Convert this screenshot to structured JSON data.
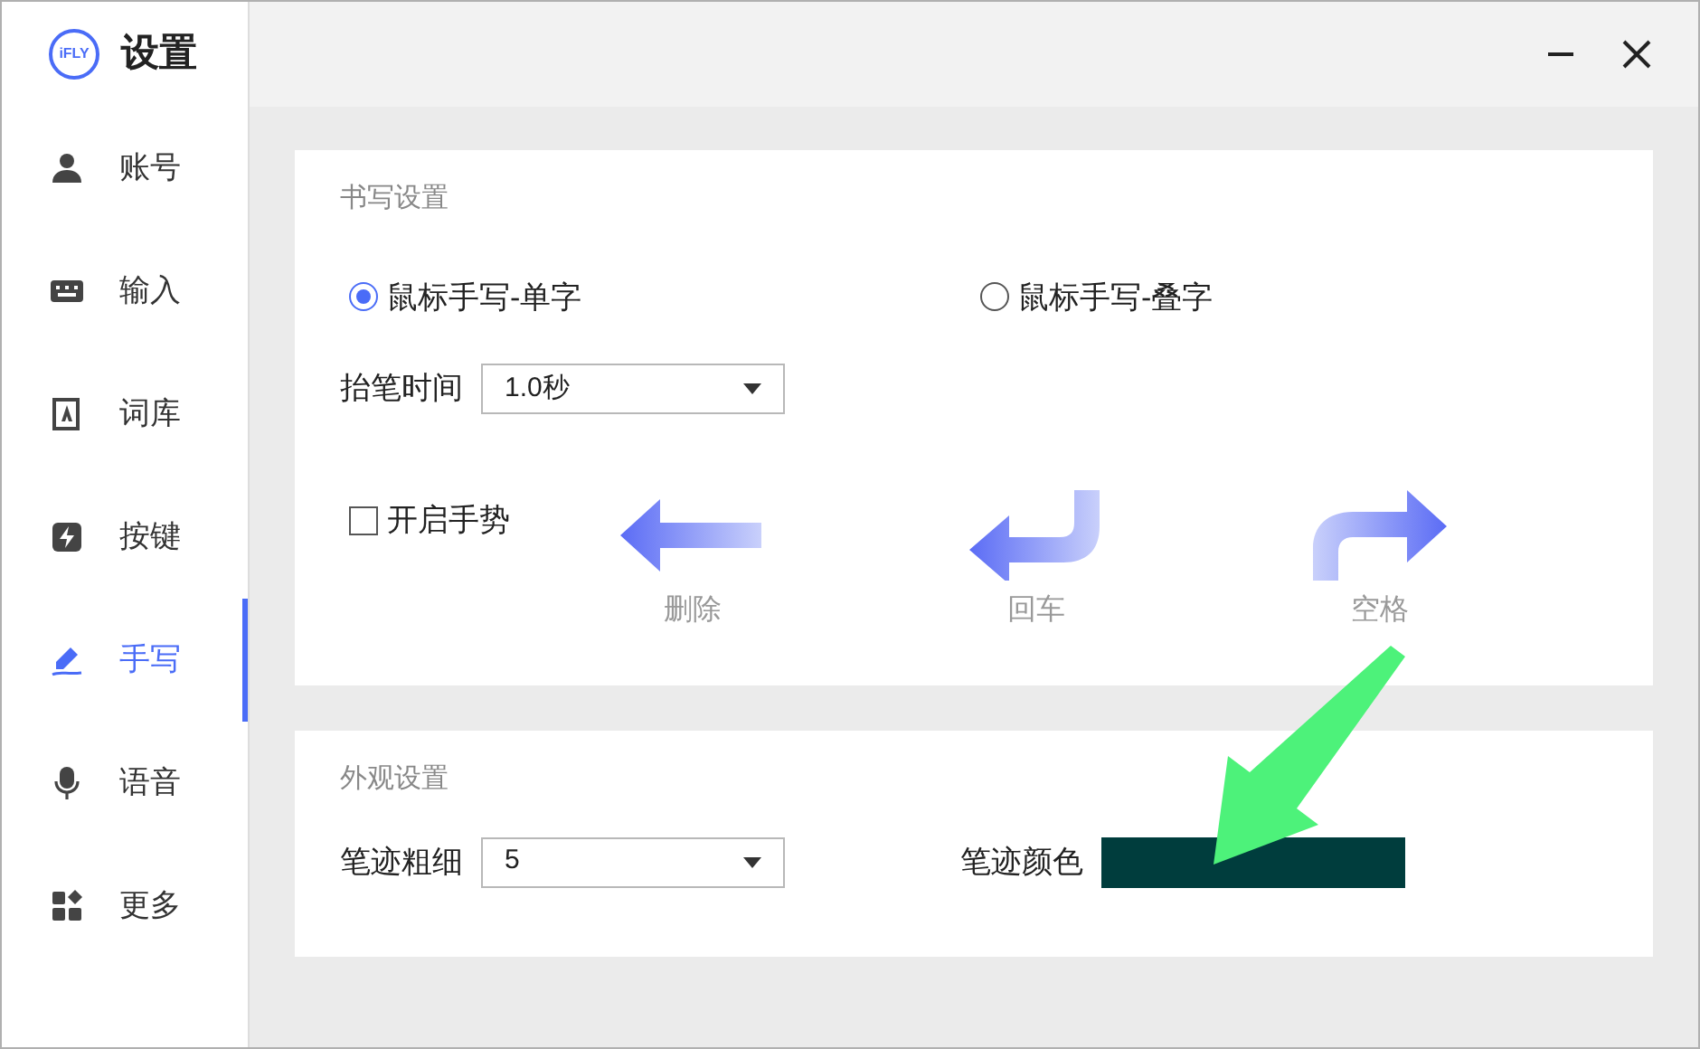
{
  "window": {
    "logo": "iFLY",
    "title": "设置"
  },
  "sidebar": {
    "items": [
      {
        "kind": "user",
        "label": "账号",
        "selected": false
      },
      {
        "kind": "keyboard",
        "label": "输入",
        "selected": false
      },
      {
        "kind": "book",
        "label": "词库",
        "selected": false
      },
      {
        "kind": "key",
        "label": "按键",
        "selected": false
      },
      {
        "kind": "pen",
        "label": "手写",
        "selected": true
      },
      {
        "kind": "mic",
        "label": "语音",
        "selected": false
      },
      {
        "kind": "more",
        "label": "更多",
        "selected": false
      }
    ]
  },
  "handwriting": {
    "title": "书写设置",
    "modes": [
      {
        "label": "鼠标手写-单字",
        "selected": true
      },
      {
        "label": "鼠标手写-叠字",
        "selected": false
      }
    ],
    "lift_time": {
      "label": "抬笔时间",
      "value": "1.0秒"
    },
    "gestures": {
      "label": "开启手势",
      "checked": false,
      "items": [
        {
          "kind": "delete",
          "label": "删除"
        },
        {
          "kind": "enter",
          "label": "回车"
        },
        {
          "kind": "space",
          "label": "空格"
        }
      ]
    }
  },
  "appearance": {
    "title": "外观设置",
    "stroke_width": {
      "label": "笔迹粗细",
      "value": "5"
    },
    "stroke_color": {
      "label": "笔迹颜色",
      "color": "#003d3d"
    }
  }
}
